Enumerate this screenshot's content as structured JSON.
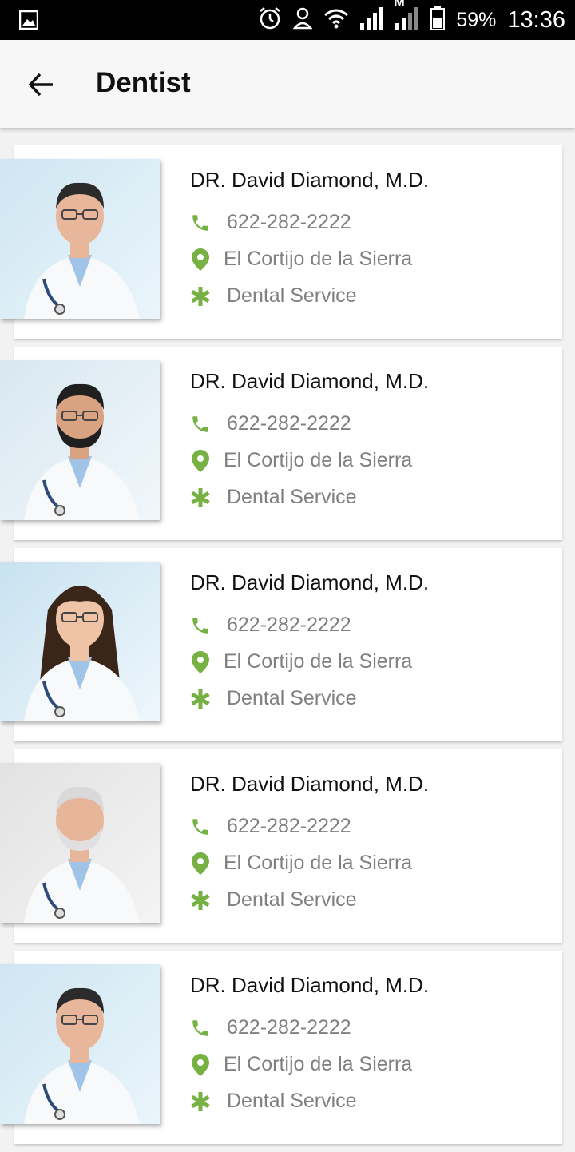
{
  "status_bar": {
    "battery": "59%",
    "time": "13:36",
    "network_label": "M"
  },
  "app_bar": {
    "title": "Dentist"
  },
  "accent_color": "#77b144",
  "doctors": [
    {
      "name": "DR. David Diamond, M.D.",
      "phone": "622-282-2222",
      "location": "El Cortijo de la Sierra",
      "service": "Dental Service",
      "avatar_style": "young-man-glasses"
    },
    {
      "name": "DR. David Diamond, M.D.",
      "phone": "622-282-2222",
      "location": "El Cortijo de la Sierra",
      "service": "Dental Service",
      "avatar_style": "bearded-man"
    },
    {
      "name": "DR. David Diamond, M.D.",
      "phone": "622-282-2222",
      "location": "El Cortijo de la Sierra",
      "service": "Dental Service",
      "avatar_style": "woman-glasses"
    },
    {
      "name": "DR. David Diamond, M.D.",
      "phone": "622-282-2222",
      "location": "El Cortijo de la Sierra",
      "service": "Dental Service",
      "avatar_style": "older-man"
    },
    {
      "name": "DR. David Diamond, M.D.",
      "phone": "622-282-2222",
      "location": "El Cortijo de la Sierra",
      "service": "Dental Service",
      "avatar_style": "young-man-glasses"
    }
  ]
}
